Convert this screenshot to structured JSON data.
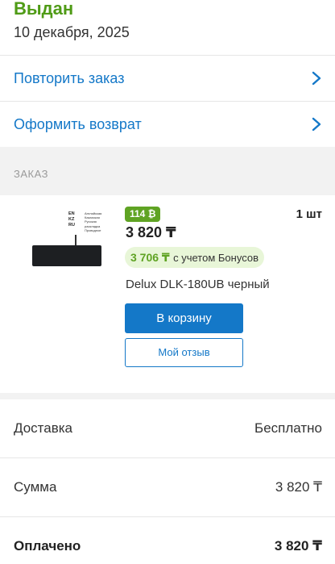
{
  "status": {
    "title": "Выдан",
    "date": "10 декабря, 2025"
  },
  "actions": [
    {
      "label": "Повторить заказ",
      "icon": "chevron-right-icon"
    },
    {
      "label": "Оформить возврат",
      "icon": "chevron-right-icon"
    }
  ],
  "order": {
    "section_label": "ЗАКАЗ",
    "item": {
      "image_tags": [
        "EN",
        "KZ",
        "RU"
      ],
      "image_legend": [
        "Английская",
        "Казахская",
        "Русская раскладка",
        "Проводное"
      ],
      "bonus_badge": "114 ₿",
      "price": "3 820 ₸",
      "quantity": "1 шт",
      "bonus_price": "3 706 ₸",
      "bonus_price_note": "с учетом Бонусов",
      "name": "Delux DLK-180UB черный",
      "cart_button": "В корзину",
      "review_button": "Мой отзыв"
    }
  },
  "summary": [
    {
      "label": "Доставка",
      "value": "Бесплатно"
    },
    {
      "label": "Сумма",
      "value": "3 820 ₸"
    },
    {
      "label": "Оплачено",
      "value": "3 820 ₸"
    }
  ],
  "colors": {
    "accent_blue": "#1478c8",
    "status_green": "#4f9b16",
    "bonus_green": "#5fa323"
  }
}
